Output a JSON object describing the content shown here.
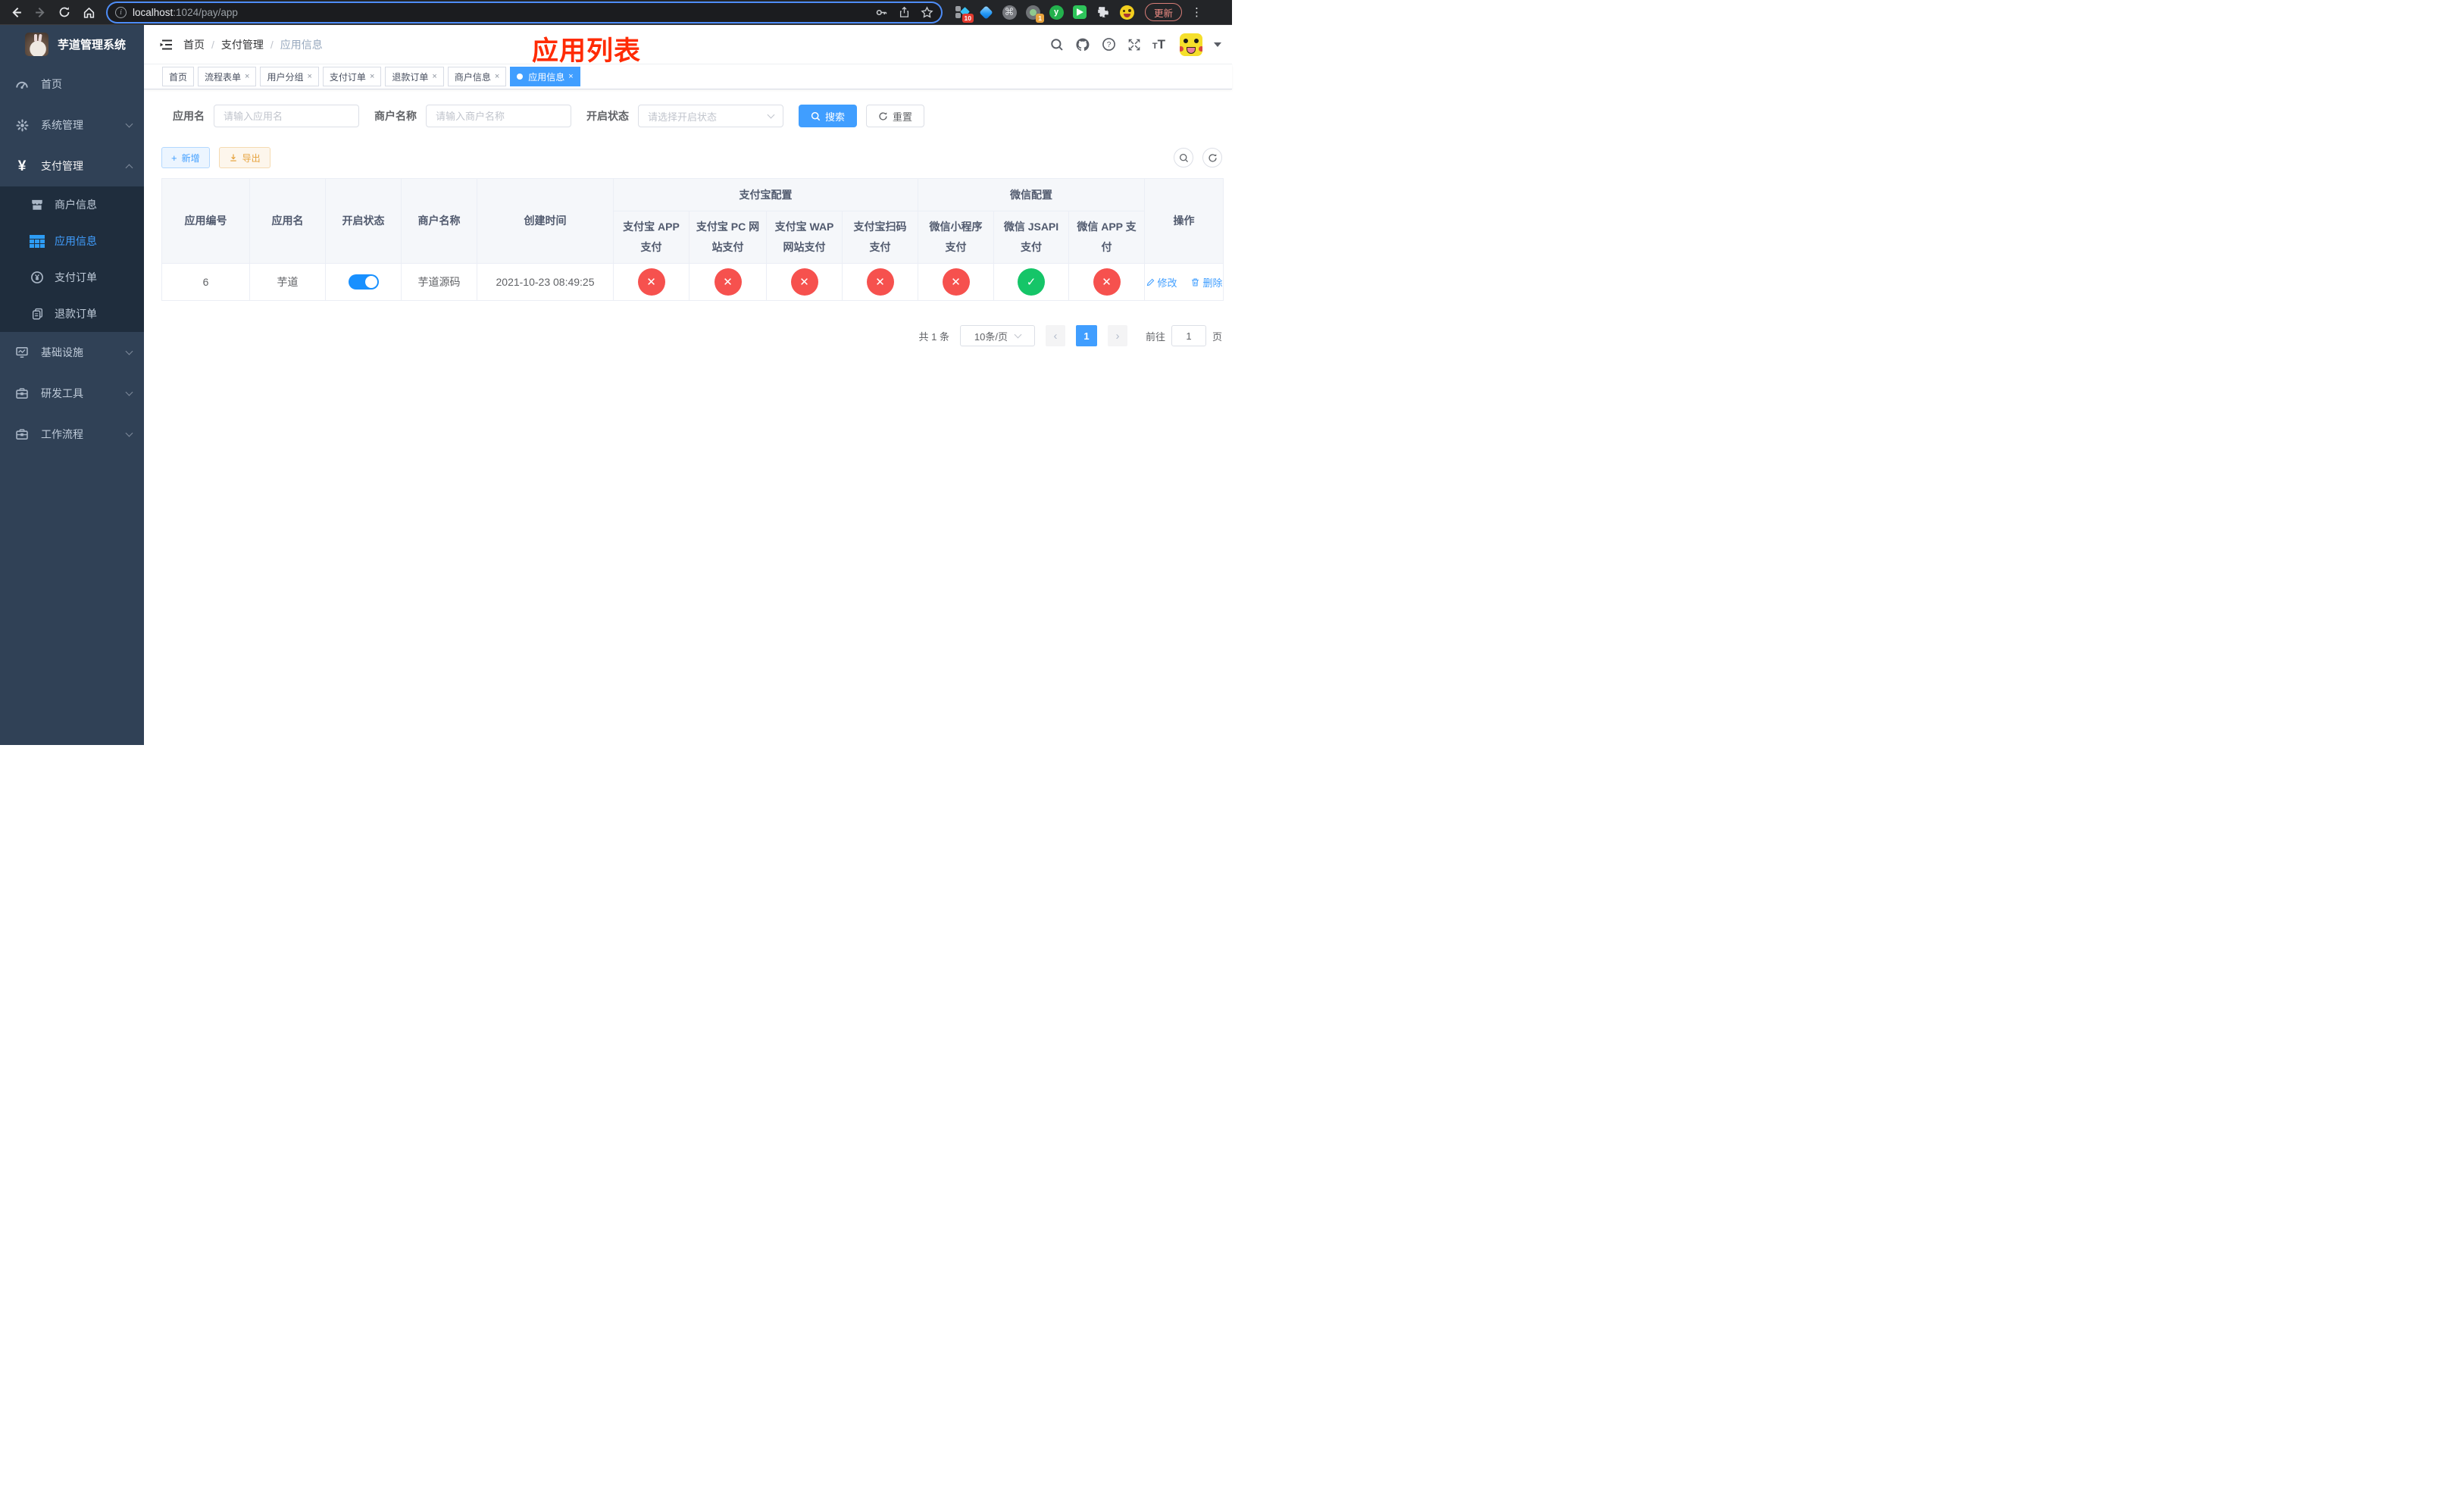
{
  "browser": {
    "url_host": "localhost",
    "url_rest": ":1024/pay/app",
    "update_button": "更新",
    "ext_badge_count": "10",
    "ext_badge_one": "1",
    "ext_letter": "y",
    "command_glyph": "⌘",
    "kebab_glyph": "⋮"
  },
  "sidebar": {
    "logo_title": "芋道管理系统",
    "items": [
      {
        "label": "首页"
      },
      {
        "label": "系统管理"
      },
      {
        "label": "支付管理"
      },
      {
        "label": "商户信息"
      },
      {
        "label": "应用信息"
      },
      {
        "label": "支付订单"
      },
      {
        "label": "退款订单"
      },
      {
        "label": "基础设施"
      },
      {
        "label": "研发工具"
      },
      {
        "label": "工作流程"
      }
    ],
    "pay_icon_glyph": "¥"
  },
  "breadcrumb": {
    "home": "首页",
    "section": "支付管理",
    "current": "应用信息",
    "separator": "/"
  },
  "annotation_title": "应用列表",
  "tabs": [
    {
      "label": "首页"
    },
    {
      "label": "流程表单"
    },
    {
      "label": "用户分组"
    },
    {
      "label": "支付订单"
    },
    {
      "label": "退款订单"
    },
    {
      "label": "商户信息"
    },
    {
      "label": "应用信息"
    }
  ],
  "filters": {
    "app_name_label": "应用名",
    "app_name_placeholder": "请输入应用名",
    "merchant_label": "商户名称",
    "merchant_placeholder": "请输入商户名称",
    "status_label": "开启状态",
    "status_placeholder": "请选择开启状态",
    "search_button": "搜索",
    "reset_button": "重置"
  },
  "toolbar": {
    "add_button": "新增",
    "export_button": "导出"
  },
  "table": {
    "headers": {
      "columns": [
        "应用编号",
        "应用名",
        "开启状态",
        "商户名称",
        "创建时间"
      ],
      "group_alipay": "支付宝配置",
      "alipay_columns": [
        "支付宝 APP 支付",
        "支付宝 PC 网站支付",
        "支付宝 WAP 网站支付",
        "支付宝扫码支付"
      ],
      "group_wechat": "微信配置",
      "wechat_columns": [
        "微信小程序支付",
        "微信 JSAPI 支付",
        "微信 APP 支付"
      ],
      "actions": "操作"
    },
    "row": {
      "id": "6",
      "name": "芋道",
      "enabled": true,
      "merchant": "芋道源码",
      "created_at": "2021-10-23 08:49:25",
      "channels": [
        false,
        false,
        false,
        false,
        false,
        true,
        false
      ],
      "edit_label": "修改",
      "delete_label": "删除"
    }
  },
  "pagination": {
    "total_label": "共 1 条",
    "page_size_label": "10条/页",
    "prev_glyph": "‹",
    "next_glyph": "›",
    "current_page": "1",
    "goto_label": "前往",
    "goto_page": "1",
    "page_unit": "页"
  },
  "glyphs": {
    "check": "✓",
    "cross": "✕",
    "close": "×"
  },
  "colors": {
    "accent": "#409eff",
    "danger": "#f6514e",
    "success": "#15c568",
    "annotation": "#ff2b04",
    "sidebar": "#304156",
    "submenu": "#1f2d3d"
  }
}
